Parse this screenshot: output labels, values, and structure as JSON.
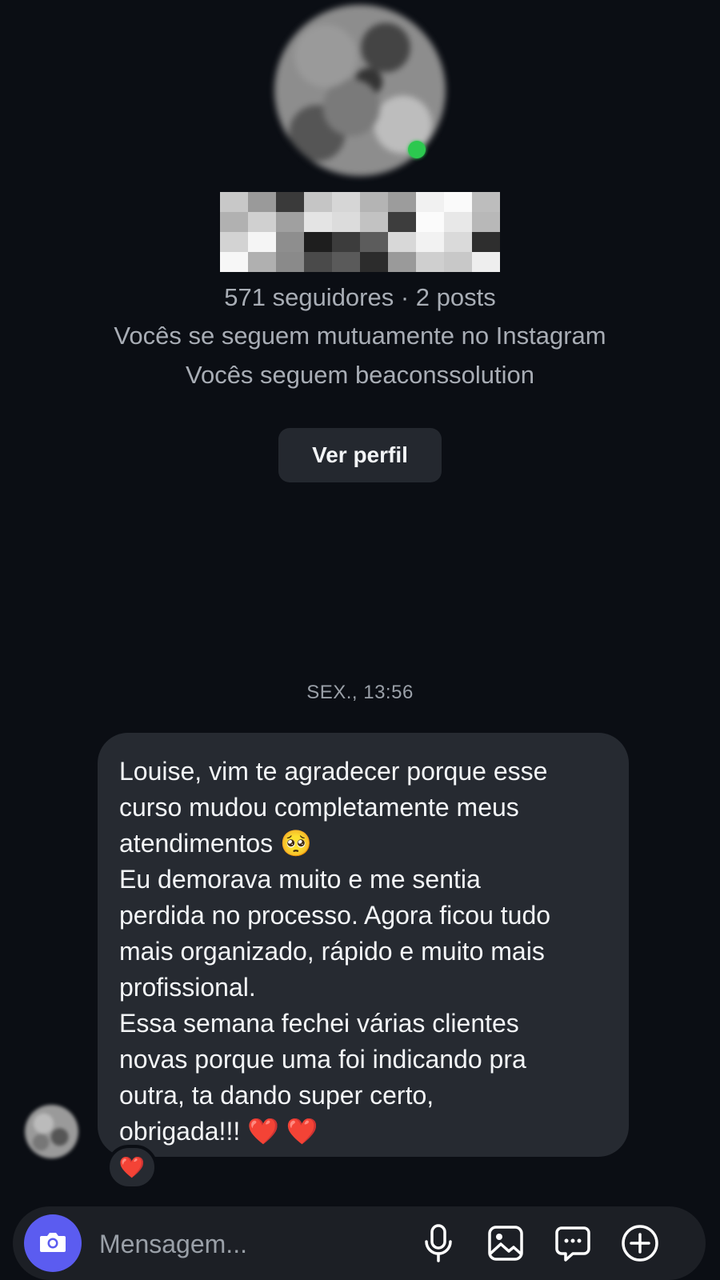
{
  "profile": {
    "stats": "571 seguidores · 2 posts",
    "mutual": "Vocês se seguem mutuamente no Instagram",
    "following": "Vocês seguem beaconssolution",
    "view_profile_label": "Ver perfil"
  },
  "thread": {
    "timestamp": "SEX., 13:56",
    "message_lines": [
      "Louise, vim te agradecer porque esse",
      "curso mudou completamente meus",
      "atendimentos 🥺",
      "Eu demorava muito e me sentia",
      "perdida no processo. Agora ficou tudo",
      "mais organizado, rápido e muito mais",
      "profissional.",
      "Essa semana fechei várias clientes",
      "novas porque uma foi indicando pra",
      "outra, ta dando super certo,",
      "obrigada!!! ❤️ ❤️"
    ],
    "reaction": "❤️"
  },
  "composer": {
    "placeholder": "Mensagem...",
    "icons": [
      "camera-icon",
      "microphone-icon",
      "gallery-icon",
      "sticker-icon",
      "plus-icon"
    ]
  },
  "colors": {
    "background": "#0b0e14",
    "bubble": "#262a31",
    "accent": "#5b5cf0",
    "online": "#2cc84f"
  }
}
